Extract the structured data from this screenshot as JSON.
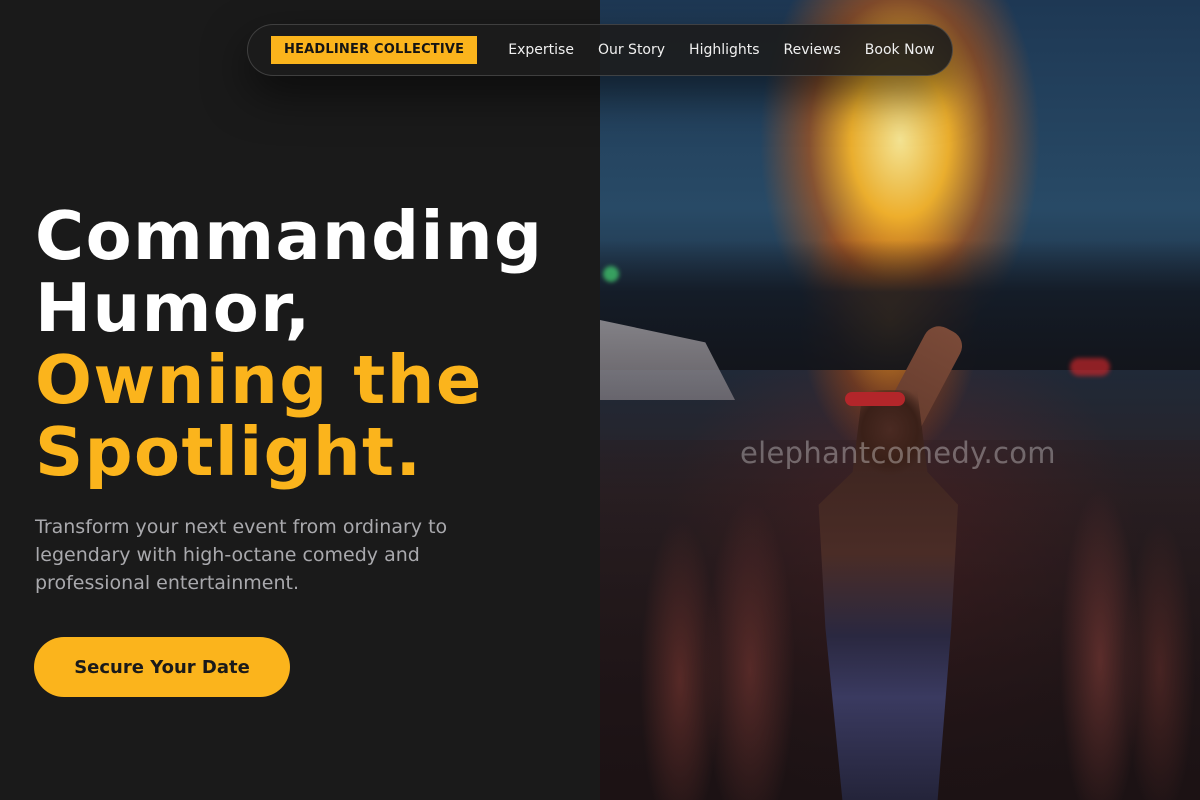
{
  "nav": {
    "brand": "HEADLINER COLLECTIVE",
    "links": [
      "Expertise",
      "Our Story",
      "Highlights",
      "Reviews",
      "Book Now"
    ]
  },
  "hero": {
    "headline_line1": "Commanding",
    "headline_line2": "Humor,",
    "headline_line3": "Owning the",
    "headline_line4": "Spotlight.",
    "subtext": "Transform your next event from ordinary to legendary with high-octane comedy and professional entertainment.",
    "cta_label": "Secure Your Date"
  },
  "image": {
    "watermark": "elephantcomedy.com",
    "description_icon": "fire-breather-photo"
  },
  "colors": {
    "accent": "#fbb41c",
    "background": "#1a1a1a",
    "text_primary": "#ffffff",
    "text_muted": "#a9a9ad"
  }
}
